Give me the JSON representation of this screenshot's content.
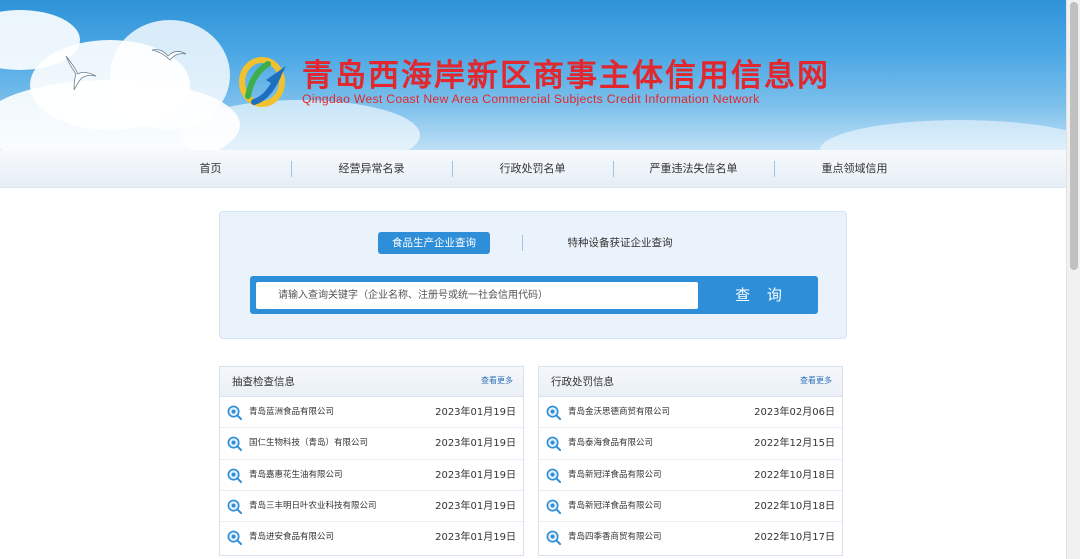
{
  "header": {
    "title": "青岛西海岸新区商事主体信用信息网",
    "subtitle": "Qingdao West Coast New Area Commercial Subjects Credit Information Network",
    "logo_icon": "site-logo"
  },
  "nav": {
    "items": [
      {
        "label": "首页"
      },
      {
        "label": "经营异常名录"
      },
      {
        "label": "行政处罚名单"
      },
      {
        "label": "严重违法失信名单"
      },
      {
        "label": "重点领域信用"
      }
    ]
  },
  "search": {
    "tabs": [
      {
        "label": "食品生产企业查询",
        "active": true
      },
      {
        "label": "特种设备获证企业查询",
        "active": false
      }
    ],
    "placeholder": "请输入查询关键字（企业名称、注册号或统一社会信用代码）",
    "button_label": "查 询"
  },
  "lists": [
    {
      "title": "抽查检查信息",
      "more": "查看更多",
      "rows": [
        {
          "name": "青岛蓝洲食品有限公司",
          "date": "2023年01月19日"
        },
        {
          "name": "国仁生物科技（青岛）有限公司",
          "date": "2023年01月19日"
        },
        {
          "name": "青岛嘉惠花生油有限公司",
          "date": "2023年01月19日"
        },
        {
          "name": "青岛三丰明日叶农业科技有限公司",
          "date": "2023年01月19日"
        },
        {
          "name": "青岛进安食品有限公司",
          "date": "2023年01月19日"
        }
      ]
    },
    {
      "title": "行政处罚信息",
      "more": "查看更多",
      "rows": [
        {
          "name": "青岛金沃思德商贸有限公司",
          "date": "2023年02月06日"
        },
        {
          "name": "青岛泰海食品有限公司",
          "date": "2022年12月15日"
        },
        {
          "name": "青岛新冠洋食品有限公司",
          "date": "2022年10月18日"
        },
        {
          "name": "青岛新冠洋食品有限公司",
          "date": "2022年10月18日"
        },
        {
          "name": "青岛四季香商贸有限公司",
          "date": "2022年10月17日"
        }
      ]
    }
  ],
  "colors": {
    "accent": "#2e8fd8",
    "title_red": "#e0282e",
    "banner_blue": "#2f93d8"
  }
}
